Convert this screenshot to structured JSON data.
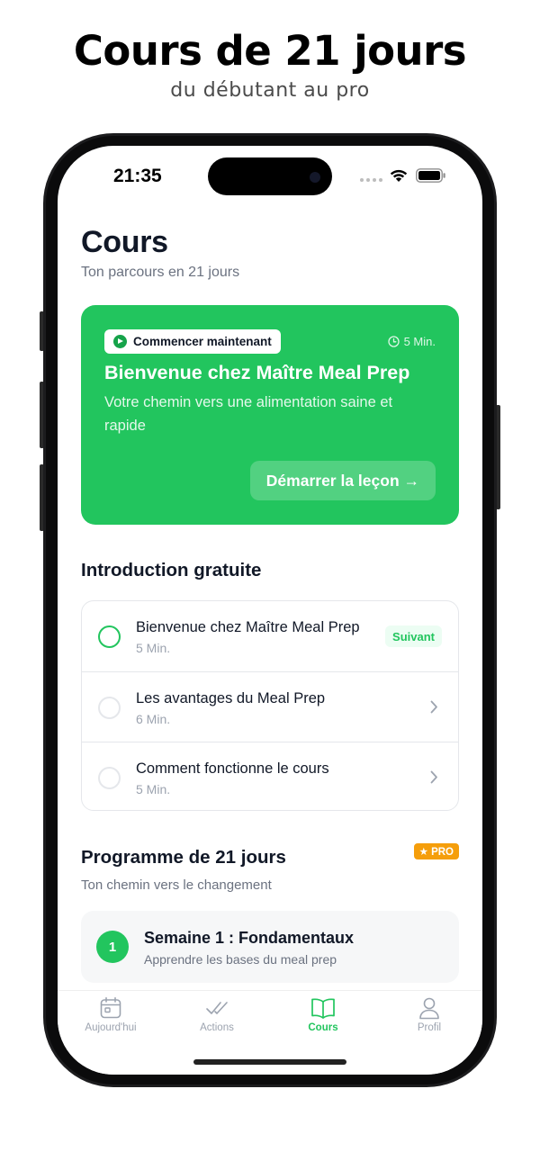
{
  "promo": {
    "title": "Cours de 21 jours",
    "subtitle": "du débutant au pro"
  },
  "status_bar": {
    "time": "21:35"
  },
  "header": {
    "title": "Cours",
    "subtitle": "Ton parcours en 21 jours"
  },
  "hero": {
    "pill_label": "Commencer maintenant",
    "duration": "5 Min.",
    "title": "Bienvenue chez Maître Meal Prep",
    "description": "Votre chemin vers une alimentation saine et rapide",
    "cta_label": "Démarrer la leçon →",
    "color": "#22c55e"
  },
  "intro_section": {
    "title": "Introduction gratuite",
    "lessons": [
      {
        "title": "Bienvenue chez Maître Meal Prep",
        "time": "5 Min.",
        "badge": "Suivant",
        "state": "next"
      },
      {
        "title": "Les avantages du Meal Prep",
        "time": "6 Min.",
        "state": "locked"
      },
      {
        "title": "Comment fonctionne le cours",
        "time": "5 Min.",
        "state": "locked"
      }
    ]
  },
  "program_section": {
    "title": "Programme de 21 jours",
    "badge": "★ PRO",
    "subtitle": "Ton chemin vers le changement",
    "weeks": [
      {
        "number": "1",
        "title": "Semaine 1 : Fondamentaux",
        "subtitle": "Apprendre les bases du meal prep"
      }
    ]
  },
  "tab_bar": {
    "tabs": [
      {
        "label": "Aujourd'hui",
        "icon": "calendar-icon"
      },
      {
        "label": "Actions",
        "icon": "checkmarks-icon"
      },
      {
        "label": "Cours",
        "icon": "book-icon",
        "active": true
      },
      {
        "label": "Profil",
        "icon": "person-icon"
      }
    ]
  },
  "colors": {
    "accent": "#22c55e",
    "pro": "#f59e0b"
  }
}
